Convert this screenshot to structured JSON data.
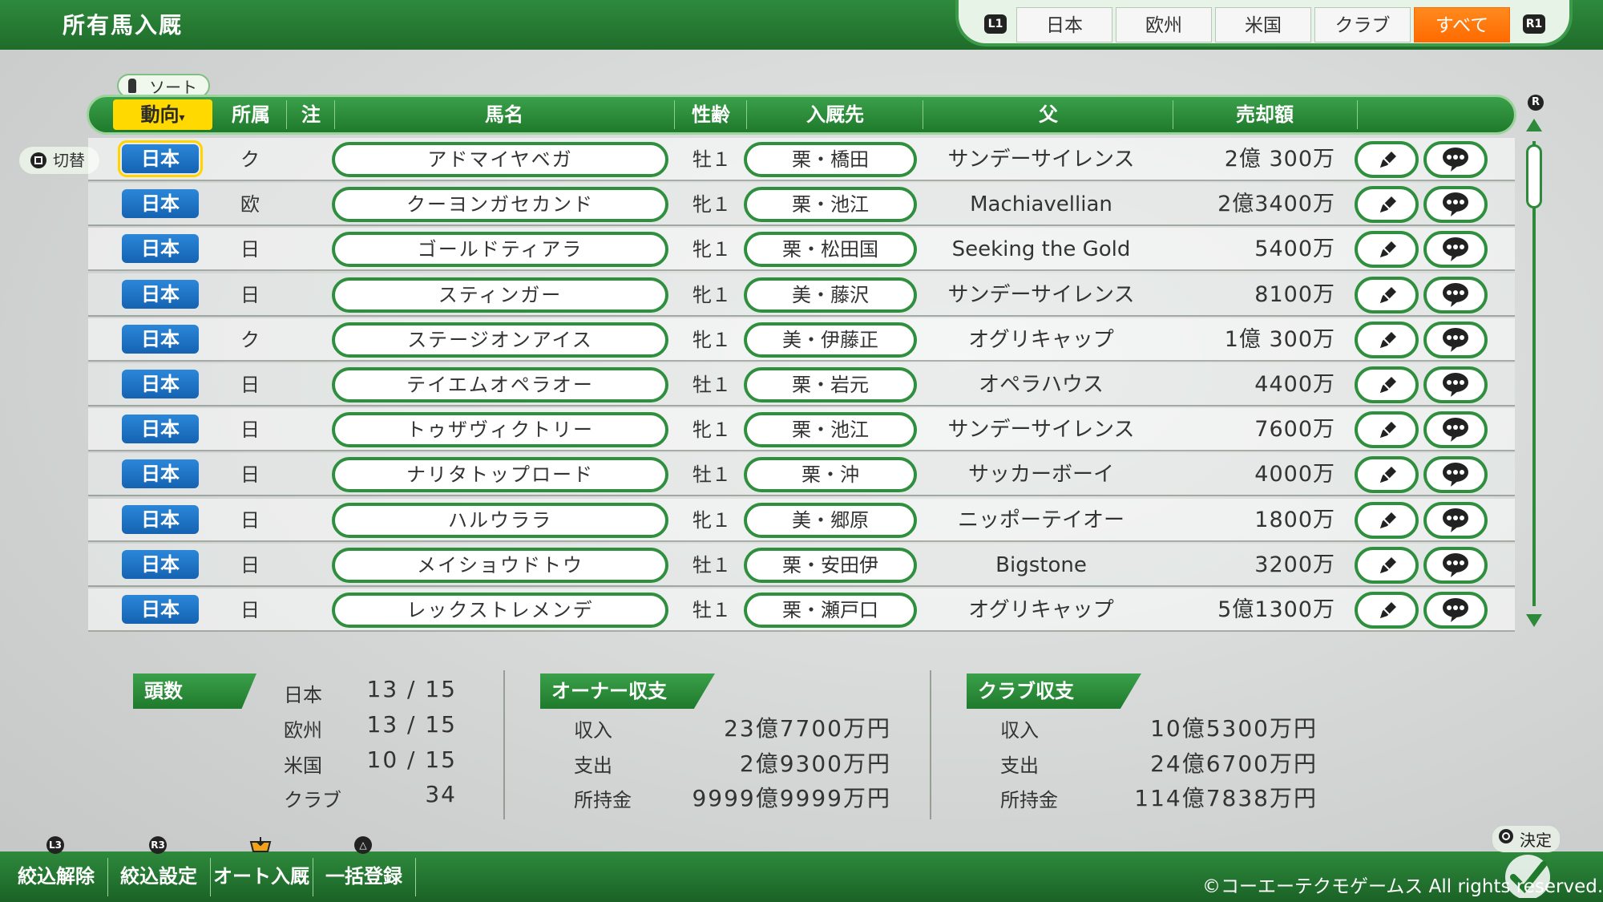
{
  "screen_title": "所有馬入厩",
  "region_tabs": {
    "l1": "L1",
    "r1": "R1",
    "items": [
      "日本",
      "欧州",
      "米国",
      "クラブ",
      "すべて"
    ],
    "active": "すべて"
  },
  "sort_label": "ソート",
  "switch_label": "切替",
  "r_hint": "R",
  "columns": {
    "trend": "動向",
    "trend_arrow": "▾",
    "affil": "所属",
    "note": "注",
    "name": "馬名",
    "sex_age": "性齢",
    "stable": "入厩先",
    "sire": "父",
    "price": "売却額"
  },
  "rows": [
    {
      "trend": "日本",
      "affil": "ク",
      "name": "アドマイヤベガ",
      "sex_age": "牡１",
      "stable": "栗・橋田",
      "sire": "サンデーサイレンス",
      "price": "2億 300万",
      "selected": true
    },
    {
      "trend": "日本",
      "affil": "欧",
      "name": "クーヨンガセカンド",
      "sex_age": "牝１",
      "stable": "栗・池江",
      "sire": "Machiavellian",
      "price": "2億3400万"
    },
    {
      "trend": "日本",
      "affil": "日",
      "name": "ゴールドティアラ",
      "sex_age": "牝１",
      "stable": "栗・松田国",
      "sire": "Seeking the Gold",
      "price": "5400万"
    },
    {
      "trend": "日本",
      "affil": "日",
      "name": "スティンガー",
      "sex_age": "牝１",
      "stable": "美・藤沢",
      "sire": "サンデーサイレンス",
      "price": "8100万"
    },
    {
      "trend": "日本",
      "affil": "ク",
      "name": "ステージオンアイス",
      "sex_age": "牝１",
      "stable": "美・伊藤正",
      "sire": "オグリキャップ",
      "price": "1億 300万"
    },
    {
      "trend": "日本",
      "affil": "日",
      "name": "テイエムオペラオー",
      "sex_age": "牡１",
      "stable": "栗・岩元",
      "sire": "オペラハウス",
      "price": "4400万"
    },
    {
      "trend": "日本",
      "affil": "日",
      "name": "トゥザヴィクトリー",
      "sex_age": "牝１",
      "stable": "栗・池江",
      "sire": "サンデーサイレンス",
      "price": "7600万"
    },
    {
      "trend": "日本",
      "affil": "日",
      "name": "ナリタトップロード",
      "sex_age": "牡１",
      "stable": "栗・沖",
      "sire": "サッカーボーイ",
      "price": "4000万"
    },
    {
      "trend": "日本",
      "affil": "日",
      "name": "ハルウララ",
      "sex_age": "牝１",
      "stable": "美・郷原",
      "sire": "ニッポーテイオー",
      "price": "1800万"
    },
    {
      "trend": "日本",
      "affil": "日",
      "name": "メイショウドトウ",
      "sex_age": "牡１",
      "stable": "栗・安田伊",
      "sire": "Bigstone",
      "price": "3200万"
    },
    {
      "trend": "日本",
      "affil": "日",
      "name": "レックストレメンデ",
      "sex_age": "牡１",
      "stable": "栗・瀬戸口",
      "sire": "オグリキャップ",
      "price": "5億1300万"
    }
  ],
  "counts": {
    "title": "頭数",
    "items": [
      {
        "label": "日本",
        "value": "13 / 15"
      },
      {
        "label": "欧州",
        "value": "13 / 15"
      },
      {
        "label": "米国",
        "value": "10 / 15"
      },
      {
        "label": "クラブ",
        "value": "34"
      }
    ]
  },
  "owner": {
    "title": "オーナー収支",
    "items": [
      {
        "label": "収入",
        "value": "23億7700万円"
      },
      {
        "label": "支出",
        "value": "2億9300万円"
      },
      {
        "label": "所持金",
        "value": "9999億9999万円"
      }
    ]
  },
  "club": {
    "title": "クラブ収支",
    "items": [
      {
        "label": "収入",
        "value": "10億5300万円"
      },
      {
        "label": "支出",
        "value": "24億6700万円"
      },
      {
        "label": "所持金",
        "value": "114億7838万円"
      }
    ]
  },
  "bottom_buttons": [
    {
      "hint": "L3",
      "label": "絞込解除"
    },
    {
      "hint": "R3",
      "label": "絞込設定"
    },
    {
      "hint": "",
      "label": "オート入厩"
    },
    {
      "hint": "△",
      "label": "一括登録"
    }
  ],
  "confirm_label": "決定",
  "copyright": "©コーエーテクモゲームス All rights reserved.",
  "colors": {
    "brand_green": "#1f7a2c",
    "accent_orange": "#ff6a00",
    "trend_blue": "#1563b2",
    "sort_yellow": "#ffd900"
  }
}
